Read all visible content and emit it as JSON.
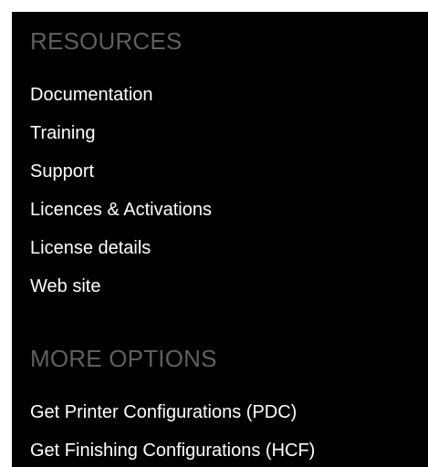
{
  "resources": {
    "title": "RESOURCES",
    "links": [
      "Documentation",
      "Training",
      "Support",
      "Licences & Activations",
      "License details",
      "Web site"
    ]
  },
  "more_options": {
    "title": "MORE OPTIONS",
    "links": [
      "Get Printer Configurations (PDC)",
      "Get Finishing Configurations (HCF)"
    ]
  },
  "colors": {
    "panel_background": "#000000",
    "section_title": "#5f5f5f",
    "link_text": "#ffffff",
    "page_background": "#ffffff"
  }
}
